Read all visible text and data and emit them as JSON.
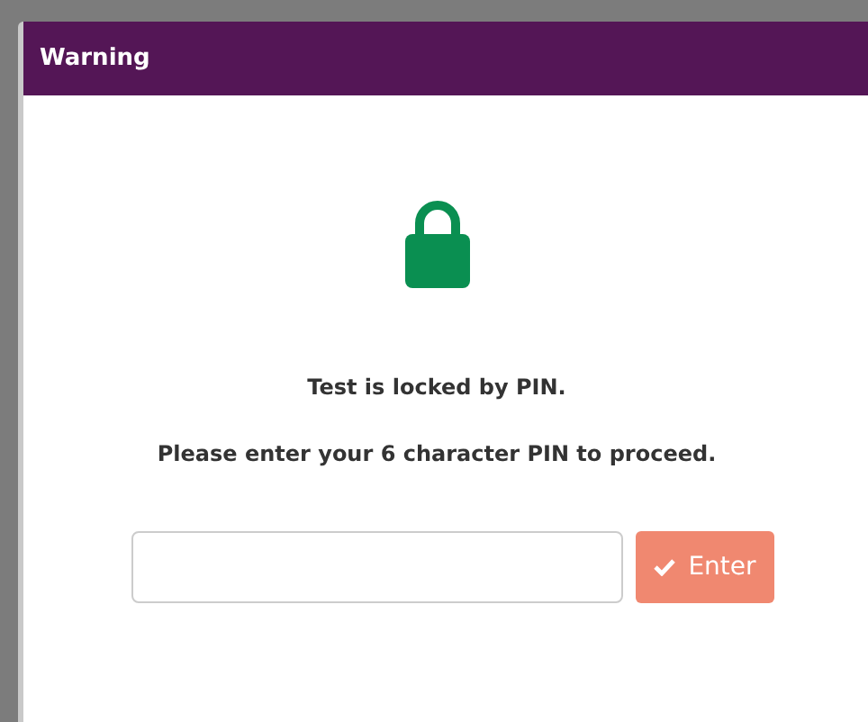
{
  "window": {
    "title": "Warning"
  },
  "messages": [
    "Test is locked by PIN.",
    "Please enter your 6 character PIN to proceed."
  ],
  "enter_button": {
    "label": "Enter"
  }
}
